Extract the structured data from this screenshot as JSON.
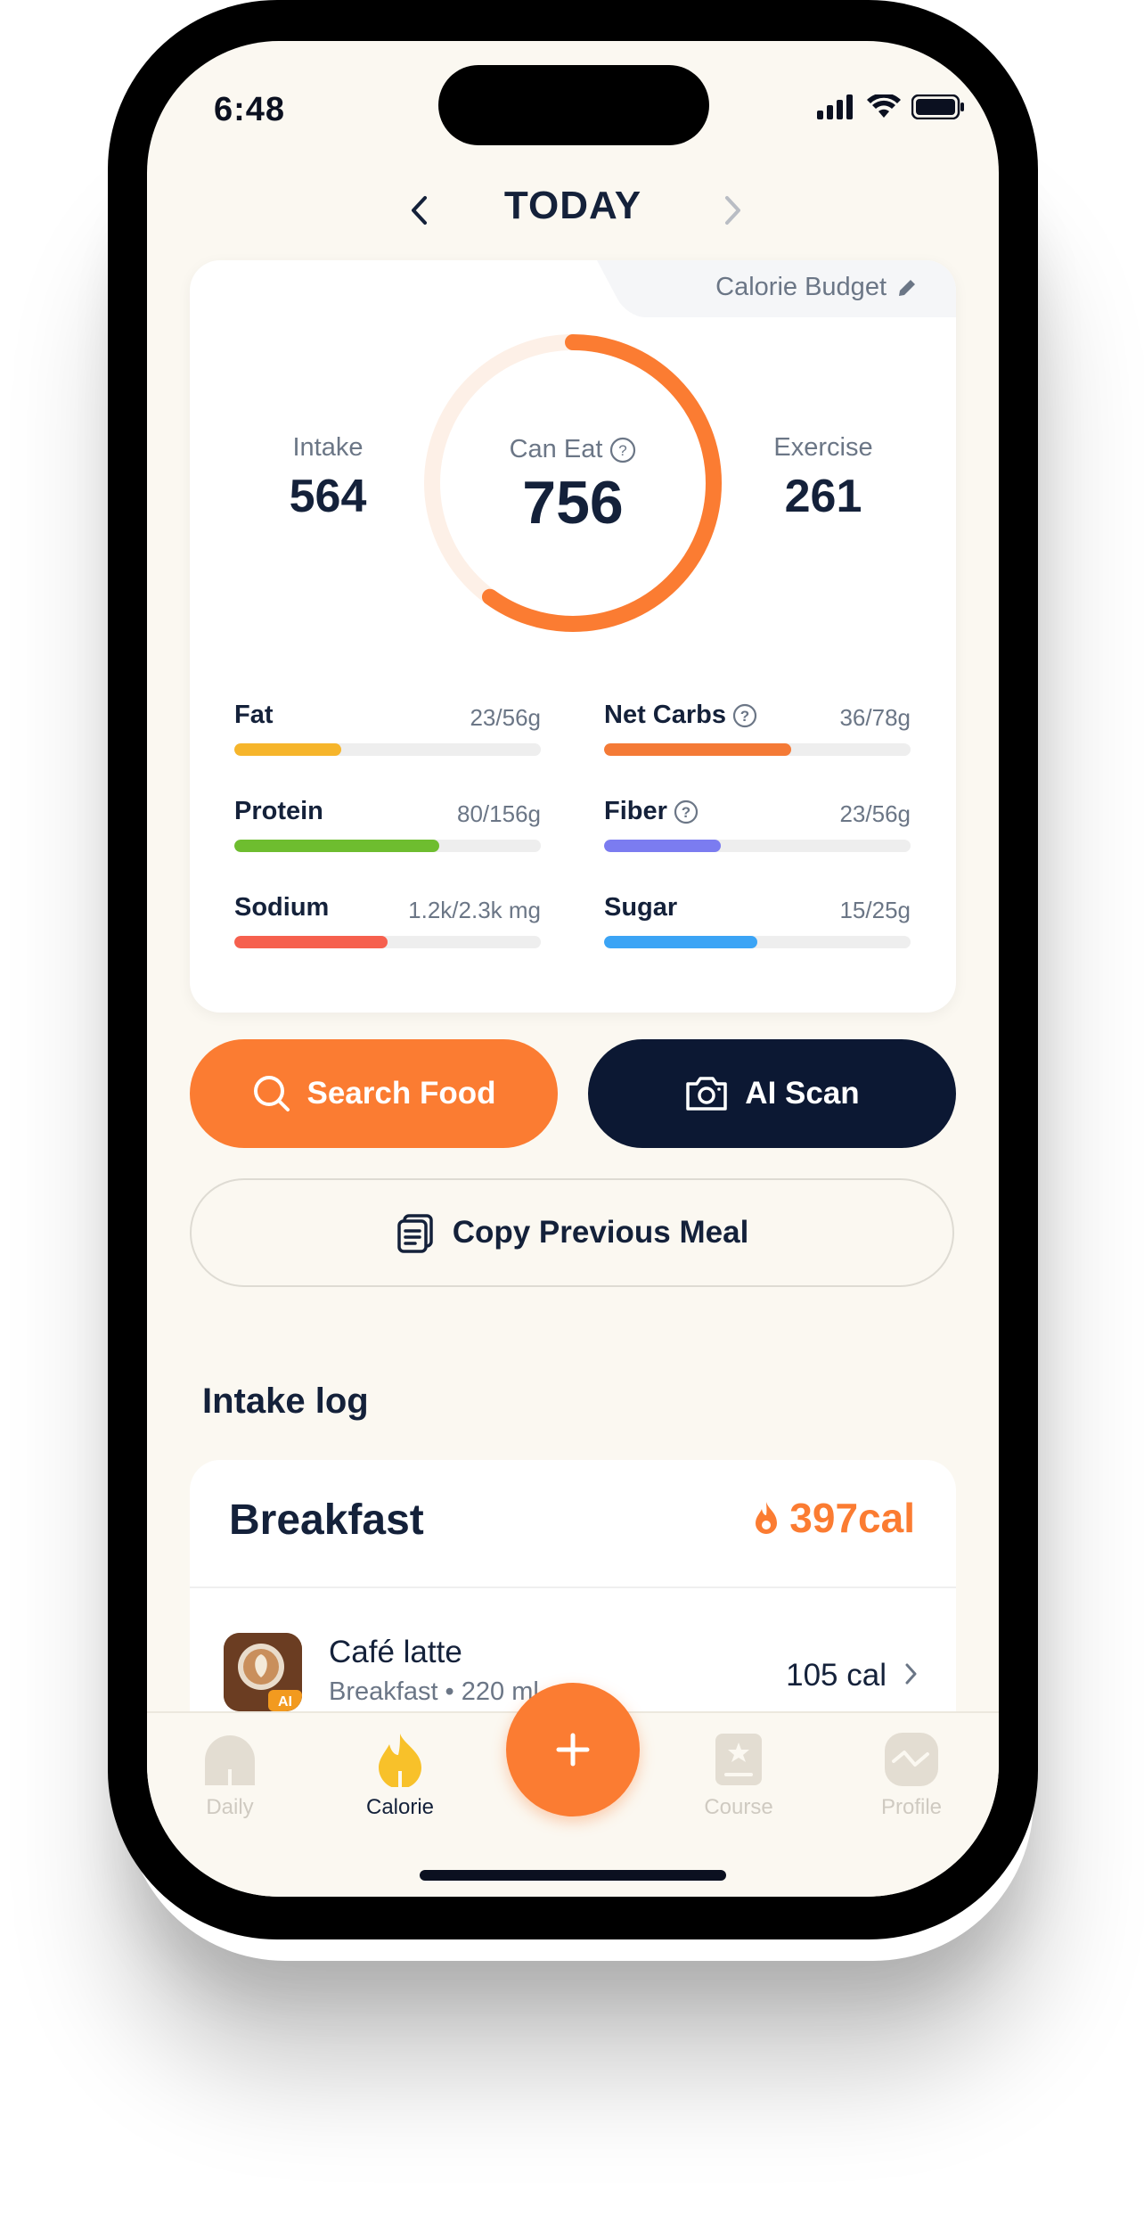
{
  "status_bar": {
    "time": "6:48"
  },
  "header": {
    "title": "TODAY"
  },
  "summary": {
    "budget_label": "Calorie Budget",
    "intake_label": "Intake",
    "intake_value": "564",
    "can_eat_label": "Can Eat",
    "can_eat_value": "756",
    "exercise_label": "Exercise",
    "exercise_value": "261",
    "ring_progress": 0.6,
    "ring_color": "#fb7c32"
  },
  "macros": [
    {
      "name": "Fat",
      "value": "23/56g",
      "fraction": 0.35,
      "color": "#f6b52b",
      "help": false
    },
    {
      "name": "Net Carbs",
      "value": "36/78g",
      "fraction": 0.61,
      "color": "#f47a36",
      "help": true
    },
    {
      "name": "Protein",
      "value": "80/156g",
      "fraction": 0.67,
      "color": "#6ebd2f",
      "help": false
    },
    {
      "name": "Fiber",
      "value": "23/56g",
      "fraction": 0.38,
      "color": "#7b7cf0",
      "help": true
    },
    {
      "name": "Sodium",
      "value": "1.2k/2.3k mg",
      "fraction": 0.5,
      "color": "#f6604e",
      "help": false
    },
    {
      "name": "Sugar",
      "value": "15/25g",
      "fraction": 0.5,
      "color": "#3ba4f5",
      "help": false
    }
  ],
  "actions": {
    "search_label": "Search Food",
    "scan_label": "AI Scan",
    "copy_label": "Copy Previous Meal"
  },
  "intake_log": {
    "title": "Intake log",
    "meal": {
      "name": "Breakfast",
      "calories": "397cal",
      "item": {
        "name": "Café latte",
        "subtitle": "Breakfast • 220 ml",
        "calories": "105 cal",
        "badge": "AI"
      }
    }
  },
  "tabs": [
    {
      "label": "Daily",
      "icon": "daily-icon",
      "active": false
    },
    {
      "label": "Calorie",
      "icon": "flame-icon",
      "active": true
    },
    {
      "label": "Course",
      "icon": "course-icon",
      "active": false
    },
    {
      "label": "Profile",
      "icon": "profile-icon",
      "active": false
    }
  ],
  "colors": {
    "accent": "#fb7c32",
    "navy": "#0c1833",
    "background": "#fbf8f1"
  }
}
